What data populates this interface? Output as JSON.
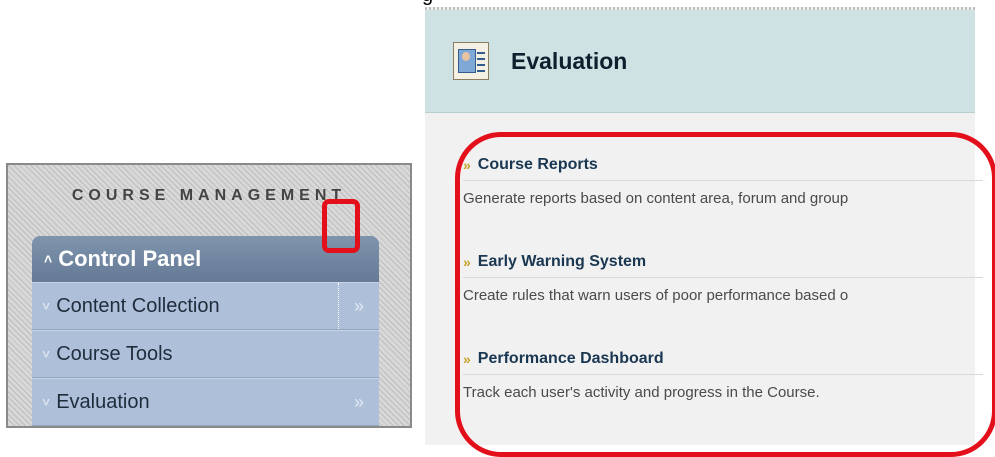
{
  "caption_fragment": "g",
  "course_management": {
    "heading": "COURSE MANAGEMENT",
    "control_panel_label": "Control Panel",
    "items": [
      {
        "label": "Content Collection"
      },
      {
        "label": "Course Tools"
      },
      {
        "label": "Evaluation"
      }
    ],
    "expand_glyph": "»",
    "collapse_glyph": "«"
  },
  "evaluation_page": {
    "title": "Evaluation",
    "tools": [
      {
        "name": "Course Reports",
        "description": "Generate reports based on content area, forum and group"
      },
      {
        "name": "Early Warning System",
        "description": "Create rules that warn users of poor performance based o"
      },
      {
        "name": "Performance Dashboard",
        "description": "Track each user's activity and progress in the Course."
      }
    ]
  },
  "colors": {
    "highlight_red": "#e3101b",
    "menu_header": "#647a95",
    "menu_item": "#aec0d9",
    "eval_header": "#cfe2e3",
    "link_arrow": "#c9a02a",
    "link_text": "#1a3752"
  }
}
